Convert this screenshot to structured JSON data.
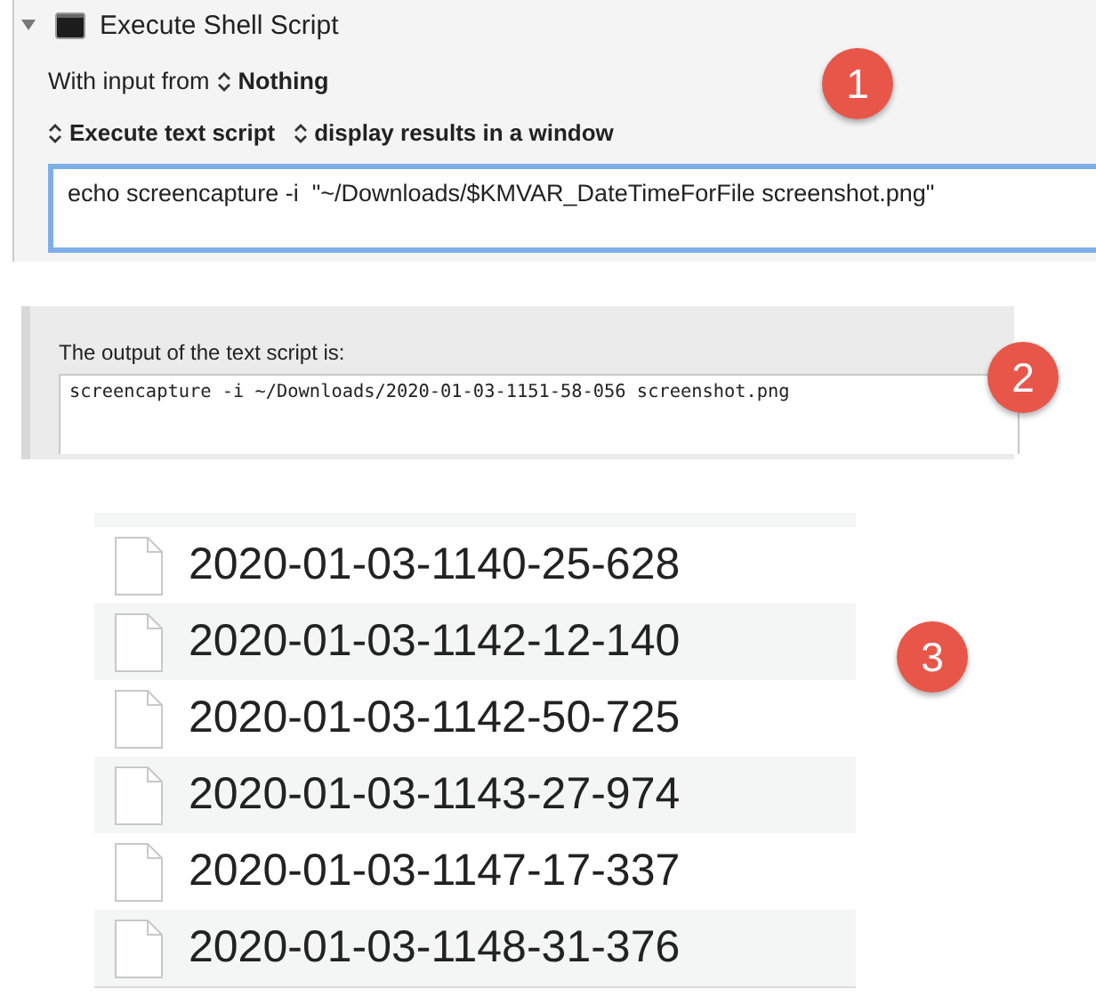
{
  "action": {
    "title": "Execute Shell Script",
    "expanded": true,
    "input_label": "With input from",
    "input_source": "Nothing",
    "mode": "Execute text script",
    "output_mode": "display results in a window",
    "script": "echo screencapture -i  \"~/Downloads/$KMVAR_DateTimeForFile screenshot.png\"",
    "badge": "1"
  },
  "output": {
    "label": "The output of the text script is:",
    "text": "screencapture -i ~/Downloads/2020-01-03-1151-58-056 screenshot.png",
    "badge": "2"
  },
  "files": {
    "badge": "3",
    "items": [
      {
        "name": "2020-01-03-1140-25-628"
      },
      {
        "name": "2020-01-03-1142-12-140"
      },
      {
        "name": "2020-01-03-1142-50-725"
      },
      {
        "name": "2020-01-03-1143-27-974"
      },
      {
        "name": "2020-01-03-1147-17-337"
      },
      {
        "name": "2020-01-03-1148-31-376"
      }
    ]
  }
}
